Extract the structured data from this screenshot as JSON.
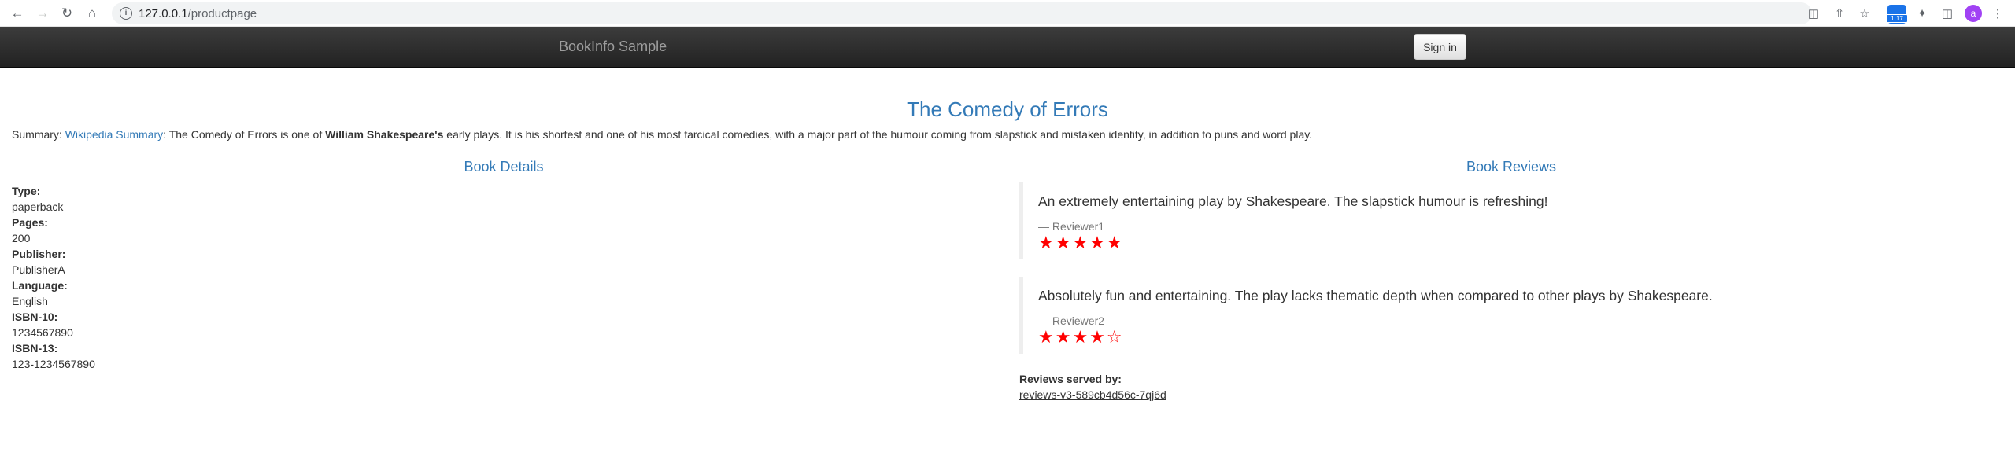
{
  "browser": {
    "url_host": "127.0.0.1",
    "url_path": "/productpage",
    "extension_badge": "1.17",
    "profile_initial": "a"
  },
  "navbar": {
    "brand": "BookInfo Sample",
    "signin_label": "Sign in"
  },
  "product": {
    "title": "The Comedy of Errors",
    "summary_label": "Summary:",
    "summary_link": "Wikipedia Summary",
    "summary_text_1": ": The Comedy of Errors is one of ",
    "summary_bold": "William Shakespeare's",
    "summary_text_2": " early plays. It is his shortest and one of his most farcical comedies, with a major part of the humour coming from slapstick and mistaken identity, in addition to puns and word play."
  },
  "details": {
    "heading": "Book Details",
    "items": [
      {
        "label": "Type:",
        "value": "paperback"
      },
      {
        "label": "Pages:",
        "value": "200"
      },
      {
        "label": "Publisher:",
        "value": "PublisherA"
      },
      {
        "label": "Language:",
        "value": "English"
      },
      {
        "label": "ISBN-10:",
        "value": "1234567890"
      },
      {
        "label": "ISBN-13:",
        "value": "123-1234567890"
      }
    ]
  },
  "reviews": {
    "heading": "Book Reviews",
    "items": [
      {
        "text": "An extremely entertaining play by Shakespeare. The slapstick humour is refreshing!",
        "reviewer": "— Reviewer1",
        "stars": "★★★★★",
        "rating": 5
      },
      {
        "text": "Absolutely fun and entertaining. The play lacks thematic depth when compared to other plays by Shakespeare.",
        "reviewer": "— Reviewer2",
        "stars": "★★★★☆",
        "rating": 4
      }
    ],
    "served_by_label": "Reviews served by:",
    "served_by_value": "reviews-v3-589cb4d56c-7qj6d"
  },
  "colors": {
    "link": "#337ab7",
    "star": "#ff0000",
    "navbar": "#222222"
  }
}
